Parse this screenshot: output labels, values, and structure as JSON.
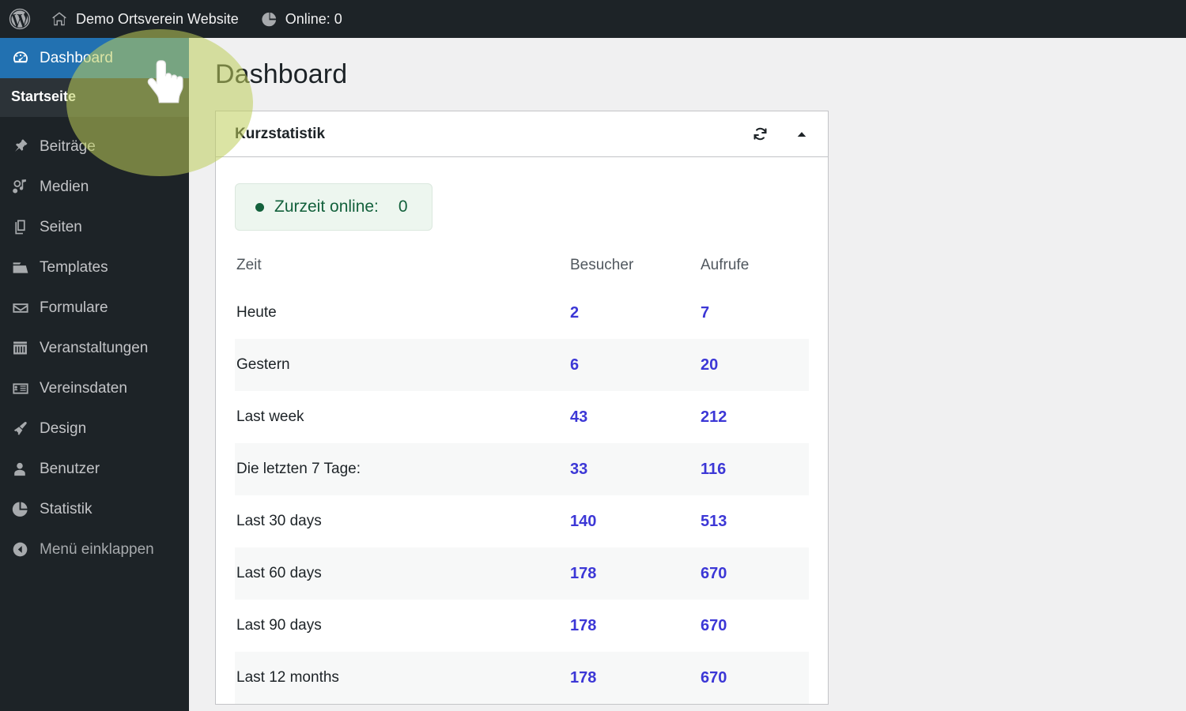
{
  "adminbar": {
    "wp_logo": "wordpress-logo",
    "site_name": "Demo Ortsverein Website",
    "online_label": "Online: 0"
  },
  "sidebar": {
    "items": [
      {
        "label": "Dashboard",
        "icon": "dashboard-icon",
        "current": true
      },
      {
        "label": "Beiträge",
        "icon": "pin-icon",
        "current": false
      },
      {
        "label": "Medien",
        "icon": "media-icon",
        "current": false
      },
      {
        "label": "Seiten",
        "icon": "pages-icon",
        "current": false
      },
      {
        "label": "Templates",
        "icon": "folder-icon",
        "current": false
      },
      {
        "label": "Formulare",
        "icon": "envelope-icon",
        "current": false
      },
      {
        "label": "Veranstaltungen",
        "icon": "calendar-icon",
        "current": false
      },
      {
        "label": "Vereinsdaten",
        "icon": "id-card-icon",
        "current": false
      },
      {
        "label": "Design",
        "icon": "paintbrush-icon",
        "current": false
      },
      {
        "label": "Benutzer",
        "icon": "user-icon",
        "current": false
      },
      {
        "label": "Statistik",
        "icon": "pie-chart-icon",
        "current": false
      }
    ],
    "submenu": {
      "label": "Startseite"
    },
    "collapse": {
      "label": "Menü einklappen",
      "icon": "collapse-arrow-icon"
    }
  },
  "main": {
    "page_title": "Dashboard"
  },
  "widget": {
    "title": "Kurzstatistik",
    "refresh_icon": "refresh-icon",
    "collapse_icon": "triangle-up-icon",
    "online_badge": {
      "label": "Zurzeit online:",
      "value": "0"
    }
  },
  "stats_table": {
    "headers": {
      "time": "Zeit",
      "visitors": "Besucher",
      "views": "Aufrufe"
    },
    "rows": [
      {
        "label": "Heute",
        "visitors": "2",
        "views": "7"
      },
      {
        "label": "Gestern",
        "visitors": "6",
        "views": "20"
      },
      {
        "label": "Last week",
        "visitors": "43",
        "views": "212"
      },
      {
        "label": "Die letzten 7 Tage:",
        "visitors": "33",
        "views": "116"
      },
      {
        "label": "Last 30 days",
        "visitors": "140",
        "views": "513"
      },
      {
        "label": "Last 60 days",
        "visitors": "178",
        "views": "670"
      },
      {
        "label": "Last 90 days",
        "visitors": "178",
        "views": "670"
      },
      {
        "label": "Last 12 months",
        "visitors": "178",
        "views": "670"
      }
    ]
  },
  "colors": {
    "admin_bar": "#1d2327",
    "sidebar": "#1d2327",
    "current_menu": "#2271b1",
    "content_bg": "#f0f0f1",
    "number_accent": "#3c37d6",
    "online_text": "#13613c",
    "online_bg": "#edf6ef",
    "highlight_circle": "#becd5a"
  }
}
